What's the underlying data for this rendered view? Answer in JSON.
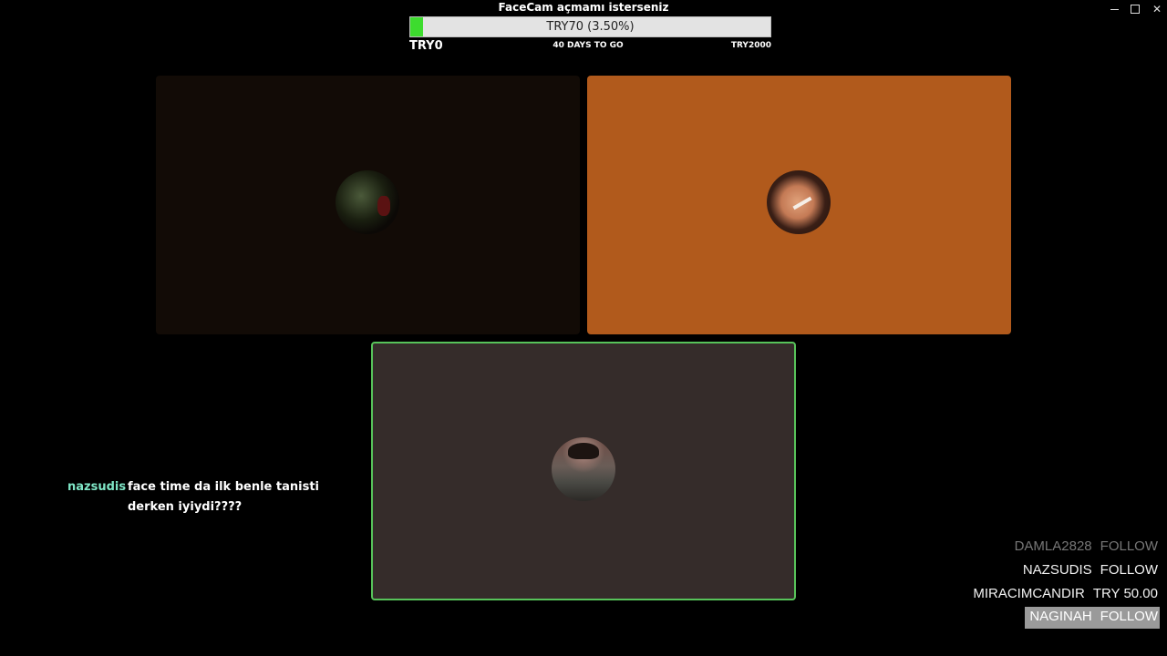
{
  "window": {
    "title": "FaceCam açmamı isterseniz"
  },
  "goal": {
    "label": "TRY70 (3.50%)",
    "progress_percent": 3.5,
    "min_label": "TRY0",
    "days_label": "40 DAYS TO GO",
    "max_label": "TRY2000",
    "fill_color": "#3ddc2e"
  },
  "tiles": [
    {
      "background": "#120b06",
      "avatar": "participant-1-avatar"
    },
    {
      "background": "#b15a1c",
      "avatar": "participant-2-avatar"
    },
    {
      "background": "#352c2a",
      "avatar": "participant-3-avatar",
      "active": true,
      "border_color": "#57c35a"
    }
  ],
  "chat": {
    "username": "nazsudis",
    "message": "face time da ilk benle tanisti derken iyiydi????",
    "username_color": "#7fe6c6"
  },
  "events": [
    {
      "user": "DAMLA2828",
      "action": "FOLLOW"
    },
    {
      "user": "NAZSUDIS",
      "action": "FOLLOW"
    },
    {
      "user": "MIRACIMCANDIR",
      "action": "TRY 50.00"
    },
    {
      "user": "NAGINAH",
      "action": "FOLLOW"
    }
  ]
}
